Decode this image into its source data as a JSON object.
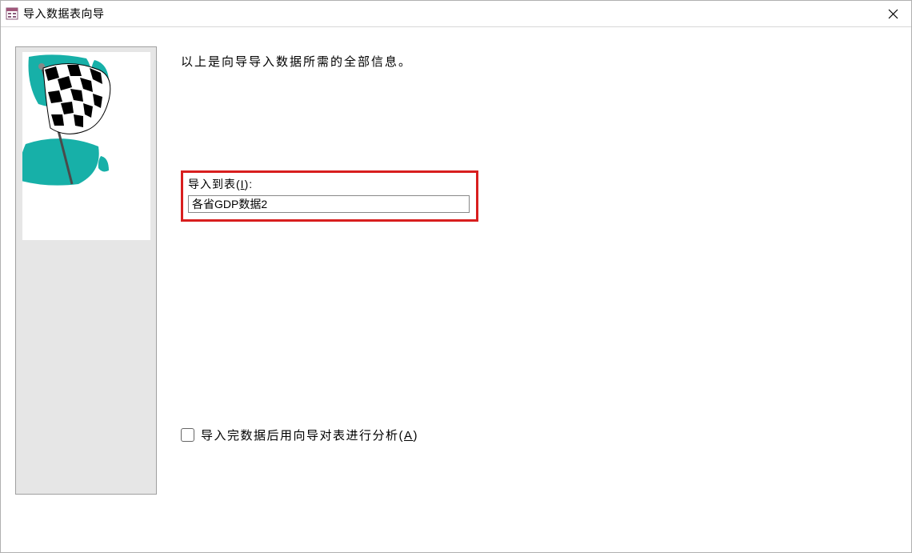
{
  "window": {
    "title": "导入数据表向导"
  },
  "main": {
    "description": "以上是向导导入数据所需的全部信息。",
    "import_label_prefix": "导入到表(",
    "import_label_key": "I",
    "import_label_suffix": "):",
    "import_table_value": "各省GDP数据2",
    "analyze_checkbox_prefix": "导入完数据后用向导对表进行分析(",
    "analyze_checkbox_key": "A",
    "analyze_checkbox_suffix": ")"
  }
}
